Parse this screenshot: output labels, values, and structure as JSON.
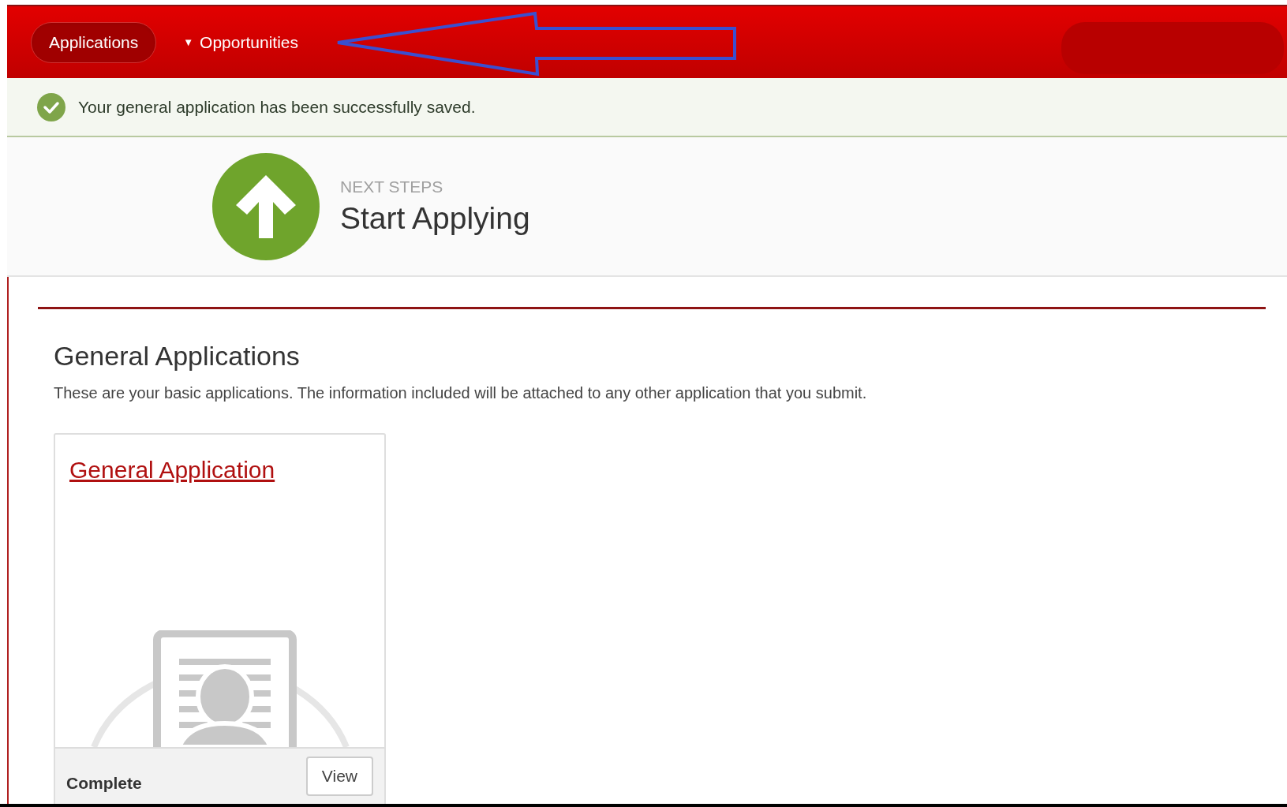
{
  "nav": {
    "tabs": [
      {
        "label": "Applications",
        "selected": true
      },
      {
        "label": "Opportunities",
        "selected": false,
        "caret": "▼"
      }
    ]
  },
  "alert": {
    "message": "Your general application has been successfully saved."
  },
  "hero": {
    "eyebrow": "NEXT STEPS",
    "title": "Start Applying"
  },
  "section": {
    "title": "General Applications",
    "description": "These are your basic applications. The information included will be attached to any other application that you submit."
  },
  "cards": [
    {
      "title": "General Application",
      "status": "Complete",
      "action": "View"
    }
  ]
}
